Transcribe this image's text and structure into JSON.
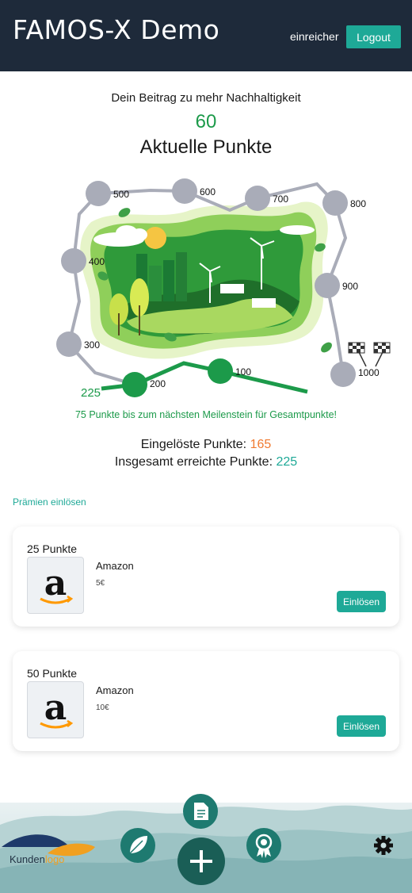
{
  "header": {
    "title": "FAMOS-X Demo",
    "user": "einreicher",
    "logout_label": "Logout"
  },
  "summary": {
    "subtitle": "Dein Beitrag zu mehr Nachhaltigkeit",
    "current_points": "60",
    "current_label": "Aktuelle Punkte",
    "milestone_message": "75 Punkte bis zum nächsten Meilenstein für Gesamtpunkte!",
    "redeemed_label": "Eingelöste Punkte:",
    "redeemed_value": "165",
    "total_label": "Insgesamt erreichte Punkte:",
    "total_value": "225"
  },
  "roadmap": {
    "current_marker": "225",
    "milestones": [
      {
        "label": "100",
        "reached": true
      },
      {
        "label": "200",
        "reached": true
      },
      {
        "label": "300",
        "reached": false
      },
      {
        "label": "400",
        "reached": false
      },
      {
        "label": "500",
        "reached": false
      },
      {
        "label": "600",
        "reached": false
      },
      {
        "label": "700",
        "reached": false
      },
      {
        "label": "800",
        "reached": false
      },
      {
        "label": "900",
        "reached": false
      },
      {
        "label": "1000",
        "reached": false
      }
    ]
  },
  "rewards": {
    "section_title": "Prämien einlösen",
    "items": [
      {
        "points": "25 Punkte",
        "name": "Amazon",
        "value": "5€",
        "button": "Einlösen",
        "logo_letter": "a"
      },
      {
        "points": "50 Punkte",
        "name": "Amazon",
        "value": "10€",
        "button": "Einlösen",
        "logo_letter": "a"
      }
    ]
  },
  "footer": {
    "logo_prefix": "Kunden",
    "logo_suffix": "logo",
    "icons": [
      "leaf-icon",
      "document-icon",
      "plus-icon",
      "award-icon",
      "gear-icon"
    ]
  },
  "colors": {
    "primary": "#1ea997",
    "header": "#1e2a3a",
    "reached": "#1c9a4a",
    "pending": "#a9acb8",
    "accent": "#f07a30"
  }
}
